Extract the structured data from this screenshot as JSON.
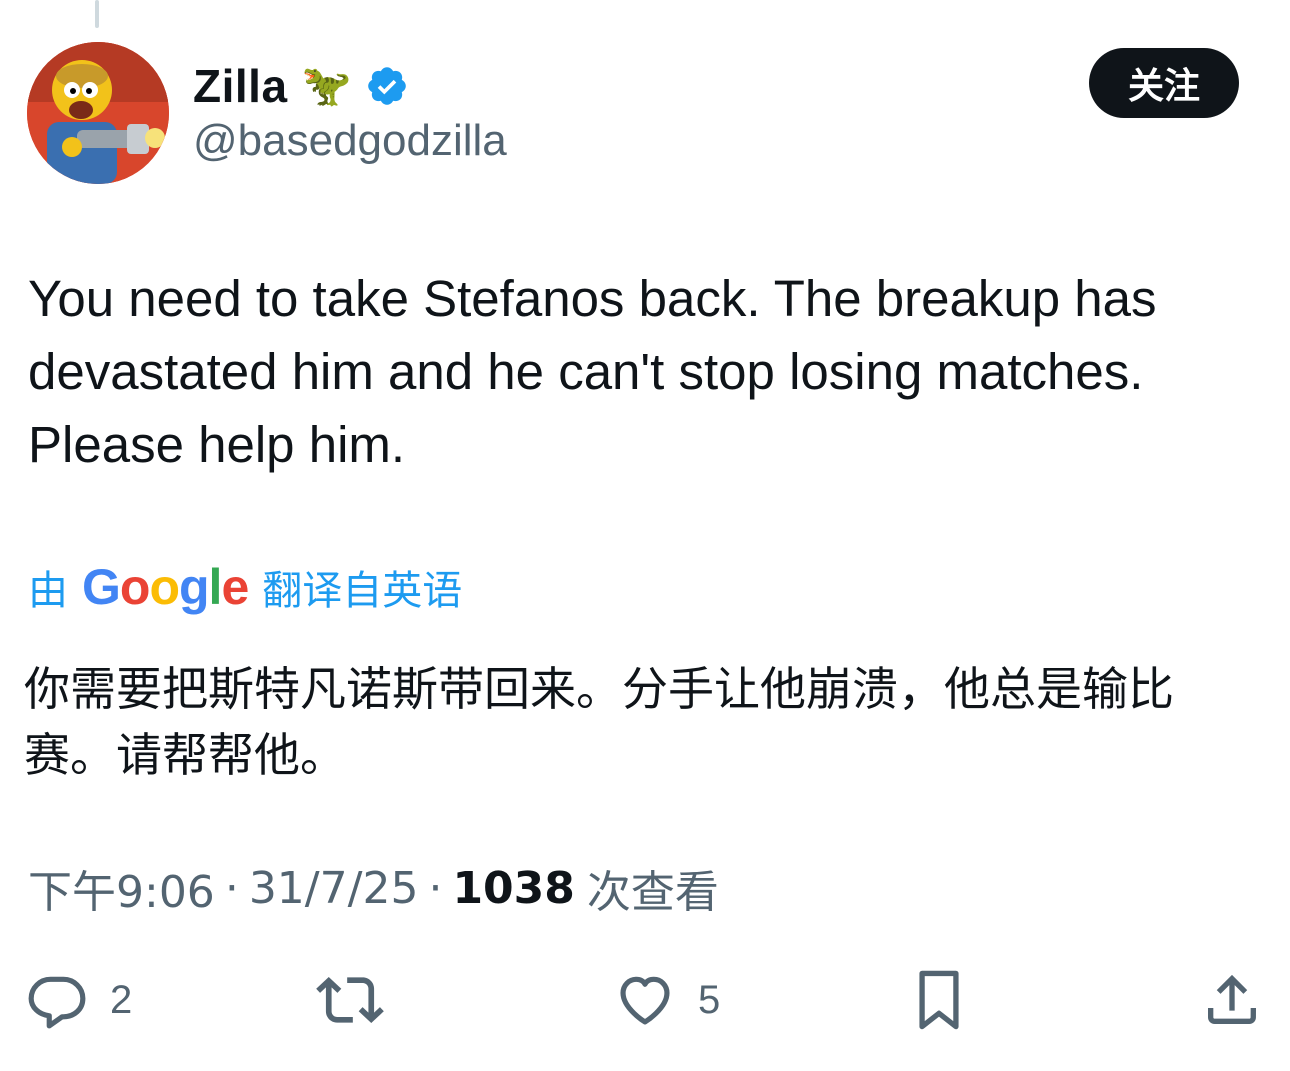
{
  "author": {
    "display_name": "Zilla",
    "name_emoji": "🦖",
    "handle": "@basedgodzilla",
    "verified": true,
    "avatar": "cartoon-character-avatar"
  },
  "follow_button": {
    "label": "关注"
  },
  "tweet": {
    "lines": [
      "You need to take Stefanos back. The breakup has",
      "devastated him and he can't stop losing matches.",
      "Please help him."
    ]
  },
  "translation": {
    "prefix": "由",
    "provider": "Google",
    "suffix": "翻译自英语",
    "lines": [
      "你需要把斯特凡诺斯带回来。分手让他崩溃，他总是输比",
      "赛。请帮帮他。"
    ]
  },
  "meta": {
    "time": "下午9:06",
    "separator": "·",
    "date": "31/7/25",
    "views_count": "1038",
    "views_label": "次查看"
  },
  "actions": {
    "reply_count": "2",
    "like_count": "5"
  },
  "colors": {
    "accent": "#1d9bf0",
    "text": "#0f1419",
    "secondary": "#536471",
    "follow_bg": "#0f1419"
  },
  "icons": {
    "reply": "reply-icon",
    "retweet": "retweet-icon",
    "like": "heart-icon",
    "bookmark": "bookmark-icon",
    "share": "share-icon",
    "verified": "verified-badge-icon"
  }
}
